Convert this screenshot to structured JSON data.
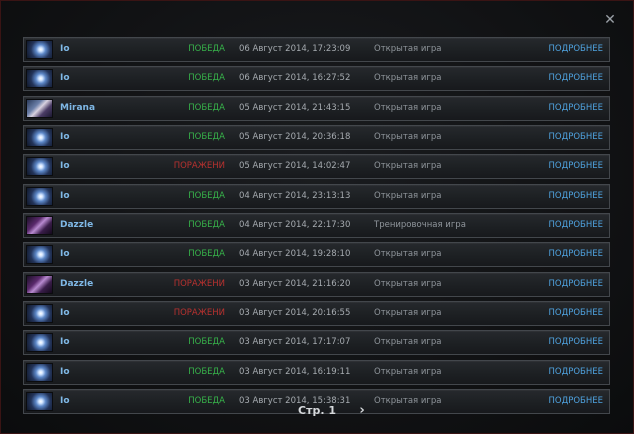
{
  "close_glyph": "✕",
  "matches": [
    {
      "hero": "Io",
      "hero_icon": "io-portrait",
      "result": "ПОБЕДА",
      "outcome": "win",
      "date": "06 Август 2014, 17:23:09",
      "mode": "Открытая игра",
      "details": "ПОДРОБНЕЕ"
    },
    {
      "hero": "Io",
      "hero_icon": "io-portrait",
      "result": "ПОБЕДА",
      "outcome": "win",
      "date": "06 Август 2014, 16:27:52",
      "mode": "Открытая игра",
      "details": "ПОДРОБНЕЕ"
    },
    {
      "hero": "Mirana",
      "hero_icon": "mirana-portrait",
      "result": "ПОБЕДА",
      "outcome": "win",
      "date": "05 Август 2014, 21:43:15",
      "mode": "Открытая игра",
      "details": "ПОДРОБНЕЕ"
    },
    {
      "hero": "Io",
      "hero_icon": "io-portrait",
      "result": "ПОБЕДА",
      "outcome": "win",
      "date": "05 Август 2014, 20:36:18",
      "mode": "Открытая игра",
      "details": "ПОДРОБНЕЕ"
    },
    {
      "hero": "Io",
      "hero_icon": "io-portrait",
      "result": "ПОРАЖЕНИ",
      "outcome": "loss",
      "date": "05 Август 2014, 14:02:47",
      "mode": "Открытая игра",
      "details": "ПОДРОБНЕЕ"
    },
    {
      "hero": "Io",
      "hero_icon": "io-portrait",
      "result": "ПОБЕДА",
      "outcome": "win",
      "date": "04 Август 2014, 23:13:13",
      "mode": "Открытая игра",
      "details": "ПОДРОБНЕЕ"
    },
    {
      "hero": "Dazzle",
      "hero_icon": "dazzle-portrait",
      "result": "ПОБЕДА",
      "outcome": "win",
      "date": "04 Август 2014, 22:17:30",
      "mode": "Тренировочная игра",
      "details": "ПОДРОБНЕЕ"
    },
    {
      "hero": "Io",
      "hero_icon": "io-portrait",
      "result": "ПОБЕДА",
      "outcome": "win",
      "date": "04 Август 2014, 19:28:10",
      "mode": "Открытая игра",
      "details": "ПОДРОБНЕЕ"
    },
    {
      "hero": "Dazzle",
      "hero_icon": "dazzle-portrait",
      "result": "ПОРАЖЕНИ",
      "outcome": "loss",
      "date": "03 Август 2014, 21:16:20",
      "mode": "Открытая игра",
      "details": "ПОДРОБНЕЕ"
    },
    {
      "hero": "Io",
      "hero_icon": "io-portrait",
      "result": "ПОРАЖЕНИ",
      "outcome": "loss",
      "date": "03 Август 2014, 20:16:55",
      "mode": "Открытая игра",
      "details": "ПОДРОБНЕЕ"
    },
    {
      "hero": "Io",
      "hero_icon": "io-portrait",
      "result": "ПОБЕДА",
      "outcome": "win",
      "date": "03 Август 2014, 17:17:07",
      "mode": "Открытая игра",
      "details": "ПОДРОБНЕЕ"
    },
    {
      "hero": "Io",
      "hero_icon": "io-portrait",
      "result": "ПОБЕДА",
      "outcome": "win",
      "date": "03 Август 2014, 16:19:11",
      "mode": "Открытая игра",
      "details": "ПОДРОБНЕЕ"
    },
    {
      "hero": "Io",
      "hero_icon": "io-portrait",
      "result": "ПОБЕДА",
      "outcome": "win",
      "date": "03 Август 2014, 15:38:31",
      "mode": "Открытая игра",
      "details": "ПОДРОБНЕЕ"
    }
  ],
  "pager": {
    "label": "Стр. 1",
    "next_glyph": "›"
  },
  "colors": {
    "win": "#37b34a",
    "loss": "#b8312f",
    "hero_name": "#7fb8e6",
    "details_link": "#4fa3e0",
    "frame_border": "#3a1414"
  }
}
